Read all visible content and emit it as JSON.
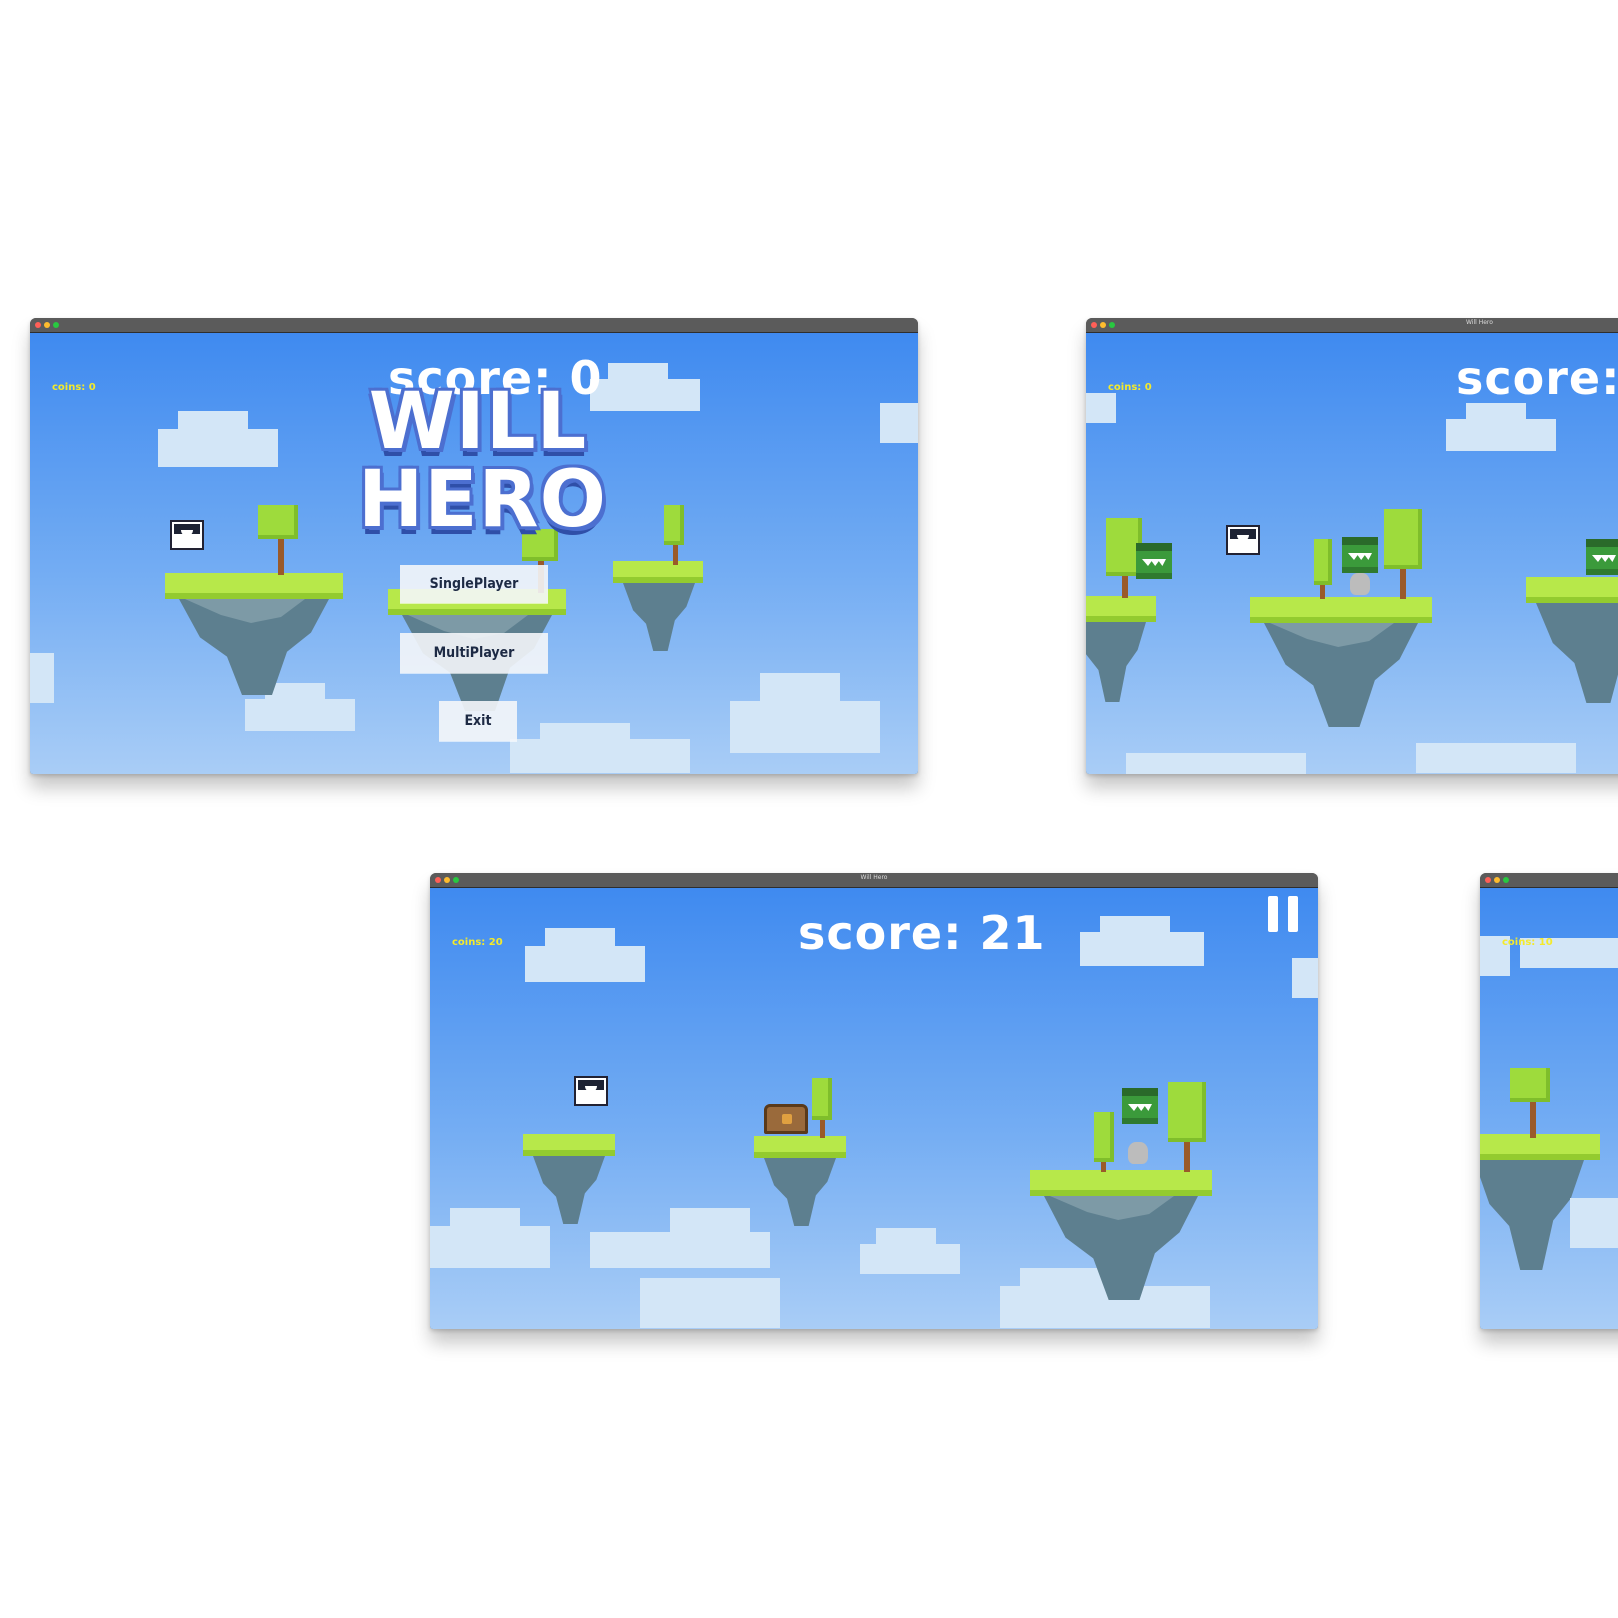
{
  "windows": {
    "menu": {
      "title": "",
      "coins": "coins: 0",
      "score": "score: 0",
      "logo_line1": "WILL",
      "logo_line2": "HERO",
      "buttons": {
        "single": "SinglePlayer",
        "multi": "MultiPlayer",
        "exit": "Exit"
      }
    },
    "game_a": {
      "title": "Will Hero",
      "coins": "coins: 0",
      "score": "score:"
    },
    "game_b": {
      "title": "Will Hero",
      "coins": "coins: 20",
      "score": "score: 21"
    },
    "game_c": {
      "title": "",
      "coins": "coins: 10"
    }
  },
  "colors": {
    "sky_top": "#3f8af0",
    "sky_bottom": "#a9cdf6",
    "coins_text": "#f4ea2a",
    "grass": "#b7e84a",
    "rock": "#5d7f8f",
    "logo_outline": "#4c6fd0"
  },
  "icons": [
    "pause-icon",
    "hero-icon",
    "orc-icon",
    "chest-icon",
    "tree-icon",
    "cloud-icon"
  ]
}
